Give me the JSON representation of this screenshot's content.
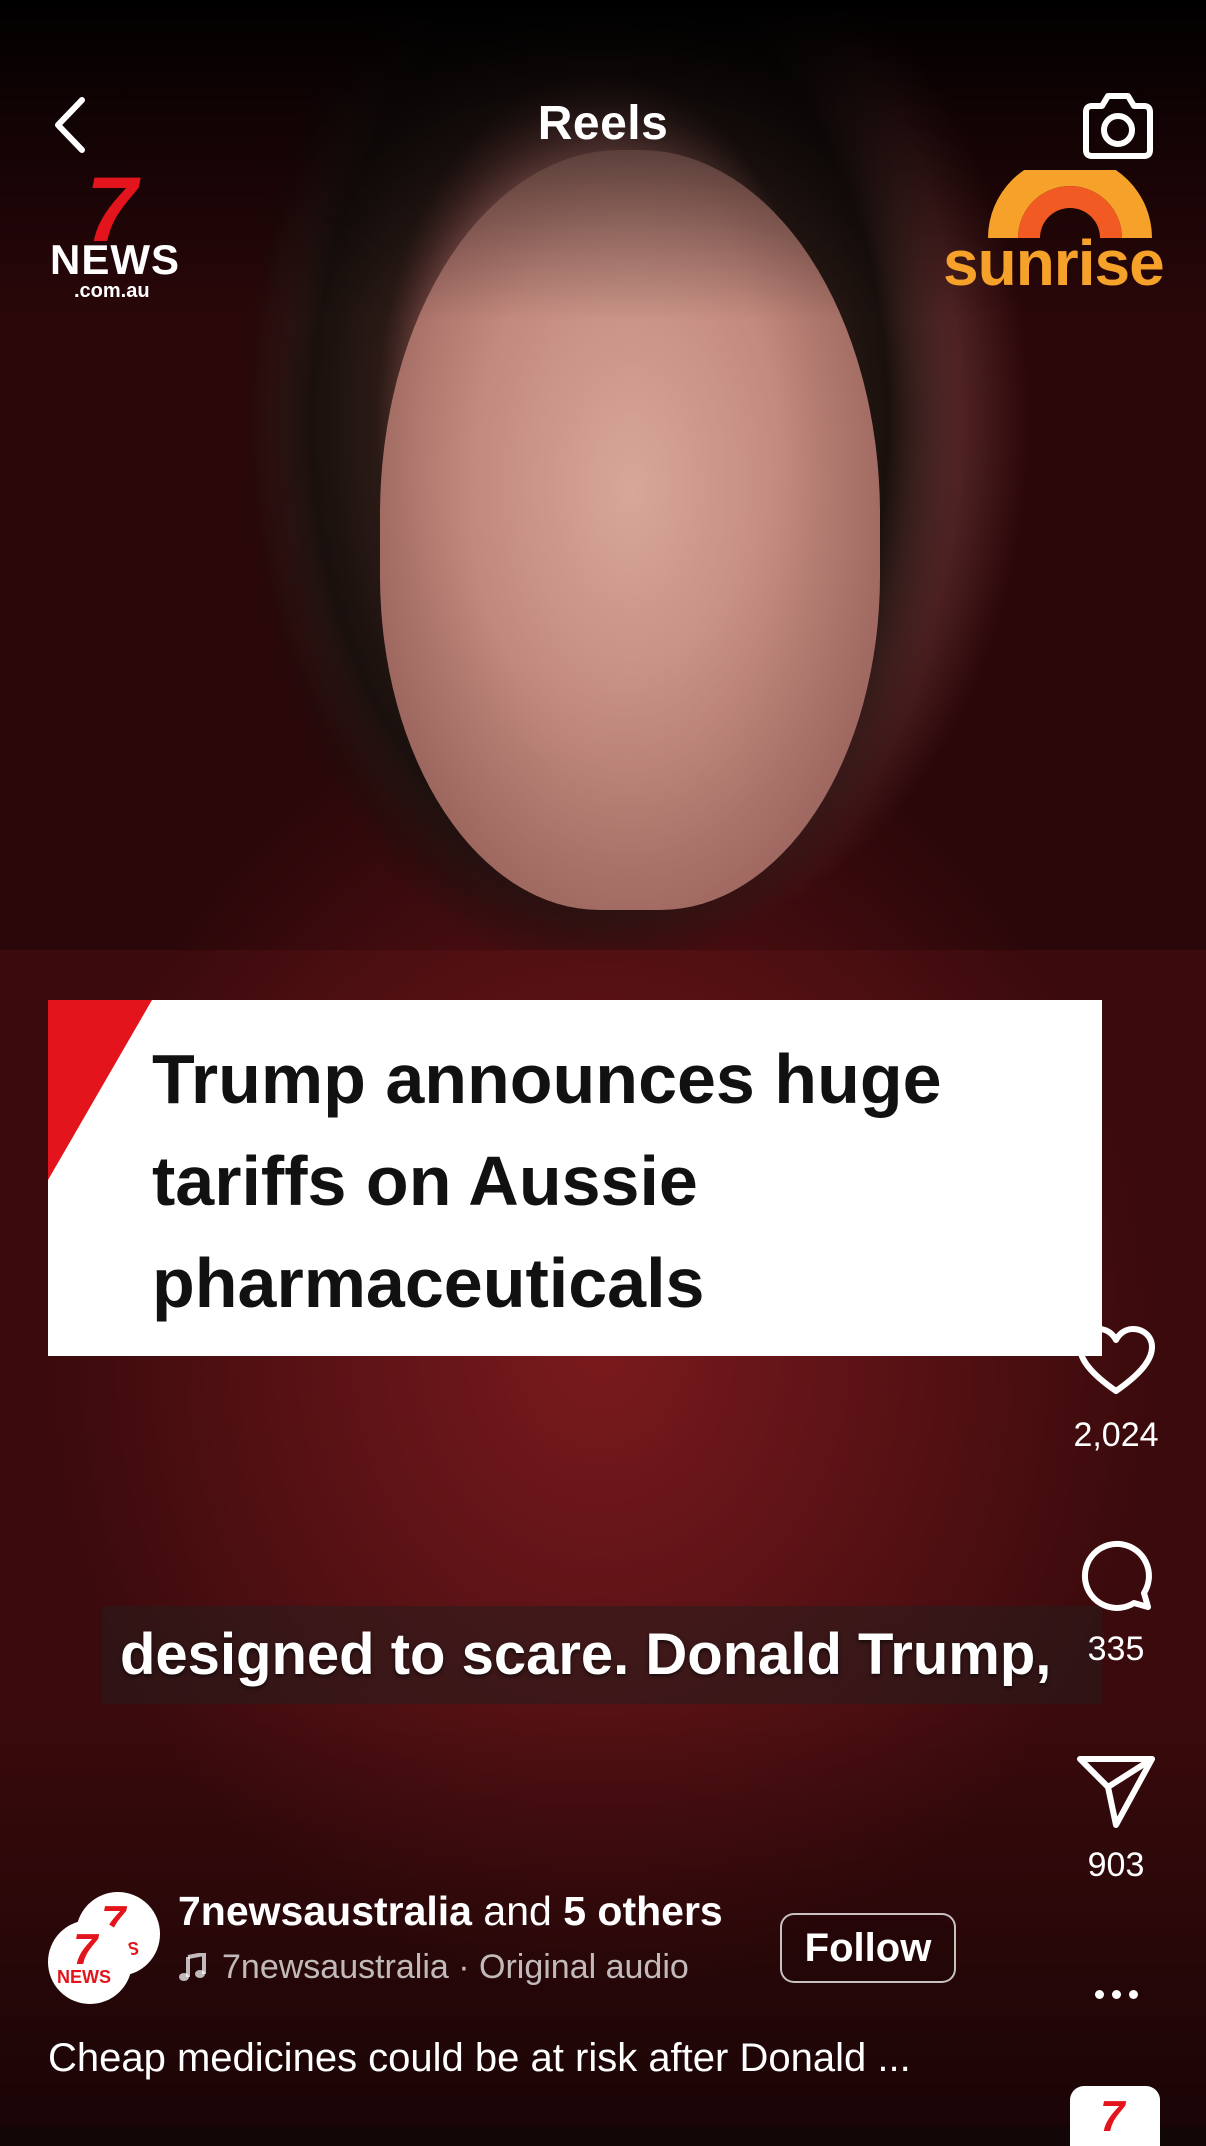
{
  "header": {
    "title": "Reels"
  },
  "logos": {
    "left_seven": "7",
    "left_news": "NEWS",
    "left_domain": ".com.au",
    "right_word": "sunrise"
  },
  "headline": {
    "lines": [
      "Trump announces huge",
      "tariffs on Aussie",
      "pharmaceuticals"
    ]
  },
  "caption": {
    "text": "designed to scare. Donald Trump,"
  },
  "actions": {
    "likes": "2,024",
    "comments": "335",
    "shares": "903"
  },
  "author": {
    "username": "7newsaustralia",
    "and_text": "and",
    "others": "5 others",
    "audio_label": "7newsaustralia · Original audio",
    "follow_label": "Follow",
    "avatar_seven": "7",
    "avatar_news": "NEWS"
  },
  "description": "Cheap medicines could be at risk after Donald ...",
  "colors": {
    "brand_red": "#e3141c",
    "sunrise_orange": "#f6a22a"
  },
  "icons": [
    "back-arrow-icon",
    "camera-icon",
    "heart-icon",
    "comment-icon",
    "share-icon",
    "more-icon",
    "music-note-icon"
  ]
}
